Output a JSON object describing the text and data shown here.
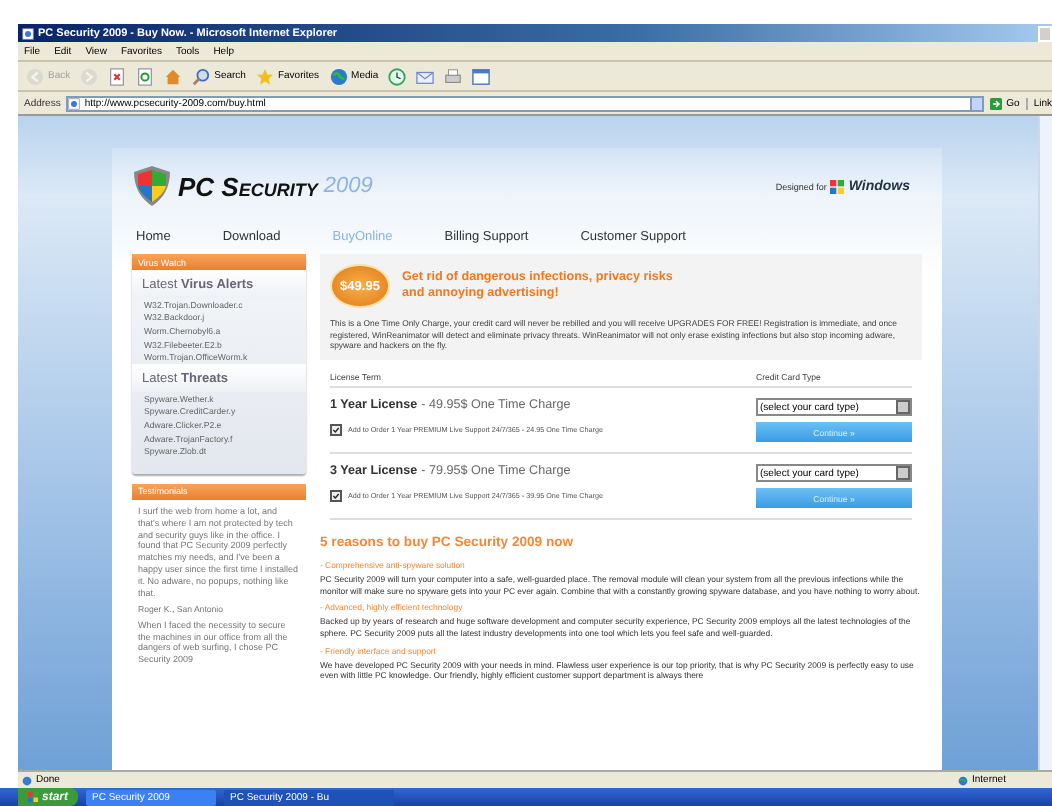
{
  "window": {
    "title": "PC Security 2009 - Buy Now. - Microsoft Internet Explorer"
  },
  "menu": [
    "File",
    "Edit",
    "View",
    "Favorites",
    "Tools",
    "Help"
  ],
  "toolbar": [
    {
      "kind": "back",
      "label": "Back",
      "disabled": true
    },
    {
      "kind": "forward",
      "disabled": true
    },
    {
      "kind": "stop",
      "disabled": false
    },
    {
      "kind": "refresh",
      "disabled": false
    },
    {
      "kind": "home",
      "disabled": false
    },
    {
      "kind": "search",
      "label": "Search",
      "disabled": false
    },
    {
      "kind": "favorites",
      "label": "Favorites",
      "disabled": false
    },
    {
      "kind": "media",
      "label": "Media",
      "disabled": false
    },
    {
      "kind": "history",
      "disabled": false
    },
    {
      "kind": "mail",
      "disabled": false
    },
    {
      "kind": "print",
      "disabled": false
    },
    {
      "kind": "edit",
      "disabled": false
    }
  ],
  "address": {
    "label": "Address",
    "url": "http://www.pcsecurity-2009.com/buy.html",
    "go": "Go",
    "links": "Link"
  },
  "page": {
    "logo": {
      "name": "PC Security",
      "year": "2009"
    },
    "designed": {
      "prefix": "Designed for",
      "brand": "Windows"
    },
    "nav": [
      {
        "label": "Home",
        "selected": false
      },
      {
        "label": "Download",
        "selected": false
      },
      {
        "label": "BuyOnline",
        "selected": true
      },
      {
        "label": "Billing Support",
        "selected": false
      },
      {
        "label": "Customer Support",
        "selected": false
      }
    ]
  },
  "sidebar": {
    "header": "Virus Watch",
    "alerts_title": "Latest **Virus Alerts**",
    "alerts": [
      "W32.Trojan.Downloader.c",
      "W32.Backdoor.j",
      "Worm.Chernobyl6.a",
      "W32.Filebeeter.E2.b",
      "Worm.Trojan.OfficeWorm.k"
    ],
    "threats_title": "Latest **Threats**",
    "threats": [
      "Spyware.Wether.k",
      "Spyware.CreditCarder.y",
      "Adware.Clicker.P2.e",
      "Adware.TrojanFactory.f",
      "Spyware.Zlob.dt"
    ],
    "testimonials_header": "Testimonials",
    "quotes": [
      {
        "text": "I surf the web from home a lot, and that's where I am not protected by tech and security guys like in the office. I found that PC Security 2009 perfectly matches my needs, and I've been a happy user since the first time I installed it. No adware, no popups, nothing like that.",
        "author": "Roger K., San Antonio"
      },
      {
        "text": "When I faced the necessity to secure the machines in our office from all the dangers of web surfing, I chose PC Security 2009"
      }
    ]
  },
  "promo": {
    "price": "$49.95",
    "headline": "Get rid of dangerous infections, privacy risks and annoying advertising!",
    "text": "This is a One Time Only Charge, your credit card will never be rebilled and you will receive UPGRADES FOR FREE! Registration is immediate, and once registered, WinReanimator will detect and eliminate privacy threats. WinReanimator will not only erase existing infections but also stop incoming adware, spyware and hackers on the fly."
  },
  "licenses": {
    "columns": [
      "License Term",
      "Credit Card Type"
    ],
    "rows": [
      {
        "title": "1 Year License",
        "price": "- 49.95$ One Time Charge",
        "addon": "Add to Order 1 Year PREMIUM Live Support 24/7/365 - 24.95 One Time Charge",
        "addon_checked": true,
        "card": "(select your card type)",
        "button": "Continue »"
      },
      {
        "title": "3 Year License",
        "price": "- 79.95$ One Time Charge",
        "addon": "Add to Order 1 Year PREMIUM Live Support 24/7/365 - 39.95 One Time Charge",
        "addon_checked": true,
        "card": "(select your card type)",
        "button": "Continue »"
      }
    ]
  },
  "reasons": {
    "title": "5 reasons to buy PC Security 2009 now",
    "items": [
      {
        "heading": "- Comprehensive anti-spyware solution",
        "text": "PC Security 2009 will turn your computer into a safe, well-guarded place. The removal module will clean your system from all the previous infections while the monitor will make sure no spyware gets into your PC ever again. Combine that with a constantly growing spyware database, and you have nothing to worry about."
      },
      {
        "heading": "- Advanced, highly efficient technology",
        "text": "Backed up by years of research and huge software development and computer security experience, PC Security 2009 employs all the latest technologies of the sphere. PC Security 2009 puts all the latest industry developments into one tool which lets you feel safe and well-guarded."
      },
      {
        "heading": "- Friendly interface and support",
        "text": "We have developed PC Security 2009 with your needs in mind. Flawless user experience is our top priority, that is why PC Security 2009 is perfectly easy to use even with little PC knowledge. Our friendly, highly efficient customer support department is always there"
      }
    ]
  },
  "status_bar": {
    "text": "Done",
    "zone": "Internet"
  },
  "taskbar": {
    "start": "start",
    "items": [
      {
        "label": "PC Security 2009",
        "selected": false
      },
      {
        "label": "PC Security 2009 - Bu",
        "selected": true
      }
    ]
  }
}
